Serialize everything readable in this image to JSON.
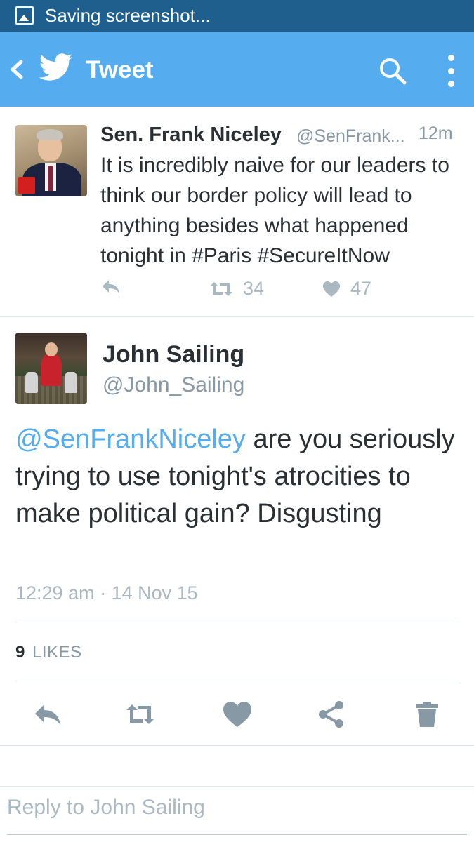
{
  "status_bar": {
    "text": "Saving screenshot..."
  },
  "app_bar": {
    "title": "Tweet"
  },
  "tweet1": {
    "name": "Sen. Frank Niceley",
    "handle": "@SenFrank...",
    "time": "12m",
    "text": "It is incredibly naive for our leaders to think our border policy will lead to anything besides what happened tonight in #Paris #SecureItNow",
    "retweets": "34",
    "likes": "47"
  },
  "tweet2": {
    "name": "John Sailing",
    "handle": "@John_Sailing",
    "mention": "@SenFrankNiceley",
    "text": " are you seriously trying to use tonight's atrocities to make political gain? Disgusting",
    "timestamp": "12:29 am · 14 Nov 15",
    "likes_count": "9",
    "likes_label": "LIKES"
  },
  "reply": {
    "placeholder": "Reply to John Sailing"
  },
  "colors": {
    "twitter_blue": "#55acee",
    "status_bar": "#1f5f8e",
    "gray_icon": "#aab8c2",
    "dark_icon": "#8899a6"
  }
}
